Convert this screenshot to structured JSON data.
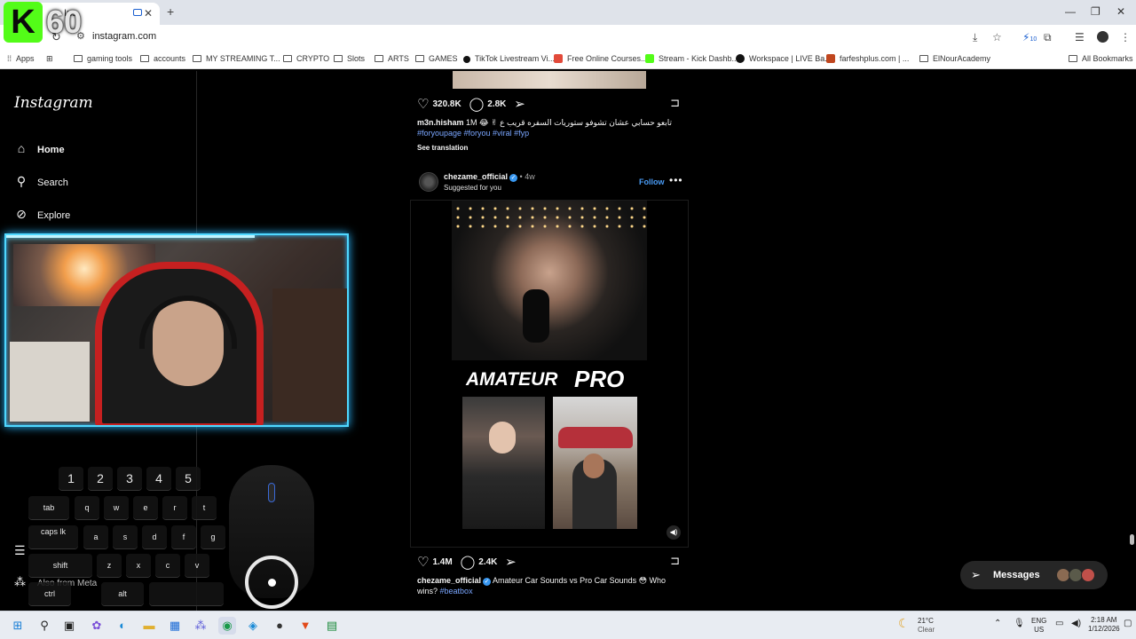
{
  "browser": {
    "tab_title": "Ins",
    "url": "instagram.com",
    "bookmarks": [
      {
        "label": "Apps",
        "kind": "apps"
      },
      {
        "label": "gaming tools",
        "kind": "folder"
      },
      {
        "label": "accounts",
        "kind": "folder"
      },
      {
        "label": "MY STREAMING T...",
        "kind": "folder"
      },
      {
        "label": "CRYPTO",
        "kind": "folder"
      },
      {
        "label": "Slots",
        "kind": "folder"
      },
      {
        "label": "ARTS",
        "kind": "folder"
      },
      {
        "label": "GAMES",
        "kind": "folder"
      },
      {
        "label": "TikTok Livestream Vi...",
        "kind": "site"
      },
      {
        "label": "Free Online Courses...",
        "kind": "site"
      },
      {
        "label": "Stream - Kick Dashb...",
        "kind": "site"
      },
      {
        "label": "Workspace | LIVE Ba...",
        "kind": "site"
      },
      {
        "label": "farfeshplus.com | ...",
        "kind": "site"
      },
      {
        "label": "ElNourAcademy",
        "kind": "folder"
      }
    ],
    "all_bookmarks": "All Bookmarks",
    "extension_badge": "10"
  },
  "overlay": {
    "kick_letter": "K",
    "kick_count": "60"
  },
  "sidebar": {
    "logo": "Instagram",
    "items": [
      {
        "label": "Home",
        "icon": "home-icon"
      },
      {
        "label": "Search",
        "icon": "search-icon"
      },
      {
        "label": "Explore",
        "icon": "explore-icon"
      }
    ],
    "also_from_meta": "Also from Meta"
  },
  "keyboard": {
    "numbers": [
      "1",
      "2",
      "3",
      "4",
      "5"
    ],
    "row1": [
      "tab",
      "q",
      "w",
      "e",
      "r",
      "t"
    ],
    "row2": [
      "caps lk",
      "a",
      "s",
      "d",
      "f",
      "g"
    ],
    "row3": [
      "shift",
      "z",
      "x",
      "c",
      "v"
    ],
    "row4": [
      "ctrl",
      "alt"
    ]
  },
  "feed": {
    "prev_post": {
      "likes": "320.8K",
      "comments": "2.8K",
      "username": "m3n.hisham",
      "caption": "1M 😂 ✌ تابعو حسابي عشان تشوفو ستوريات السفره قريب ع",
      "tags": "#foryoupage #foryou #viral #fyp",
      "see_translation": "See translation"
    },
    "post": {
      "username": "chezame_official",
      "time": "4w",
      "suggested": "Suggested for you",
      "follow": "Follow",
      "label_left": "AMATEUR",
      "label_right": "PRO",
      "likes": "1.4M",
      "comments": "2.4K",
      "caption": "Amateur Car Sounds vs Pro Car Sounds 😳 Who wins?",
      "tags": "#beatbox"
    }
  },
  "messages": {
    "label": "Messages"
  },
  "taskbar": {
    "temp": "21°C",
    "weather": "Clear",
    "lang1": "ENG",
    "lang2": "US",
    "time": "2:18 AM",
    "date": "1/12/2026"
  },
  "colors": {
    "accent_blue": "#4a9cf6",
    "kick_green": "#53fc18",
    "cam_glow": "#4fd8ff"
  }
}
